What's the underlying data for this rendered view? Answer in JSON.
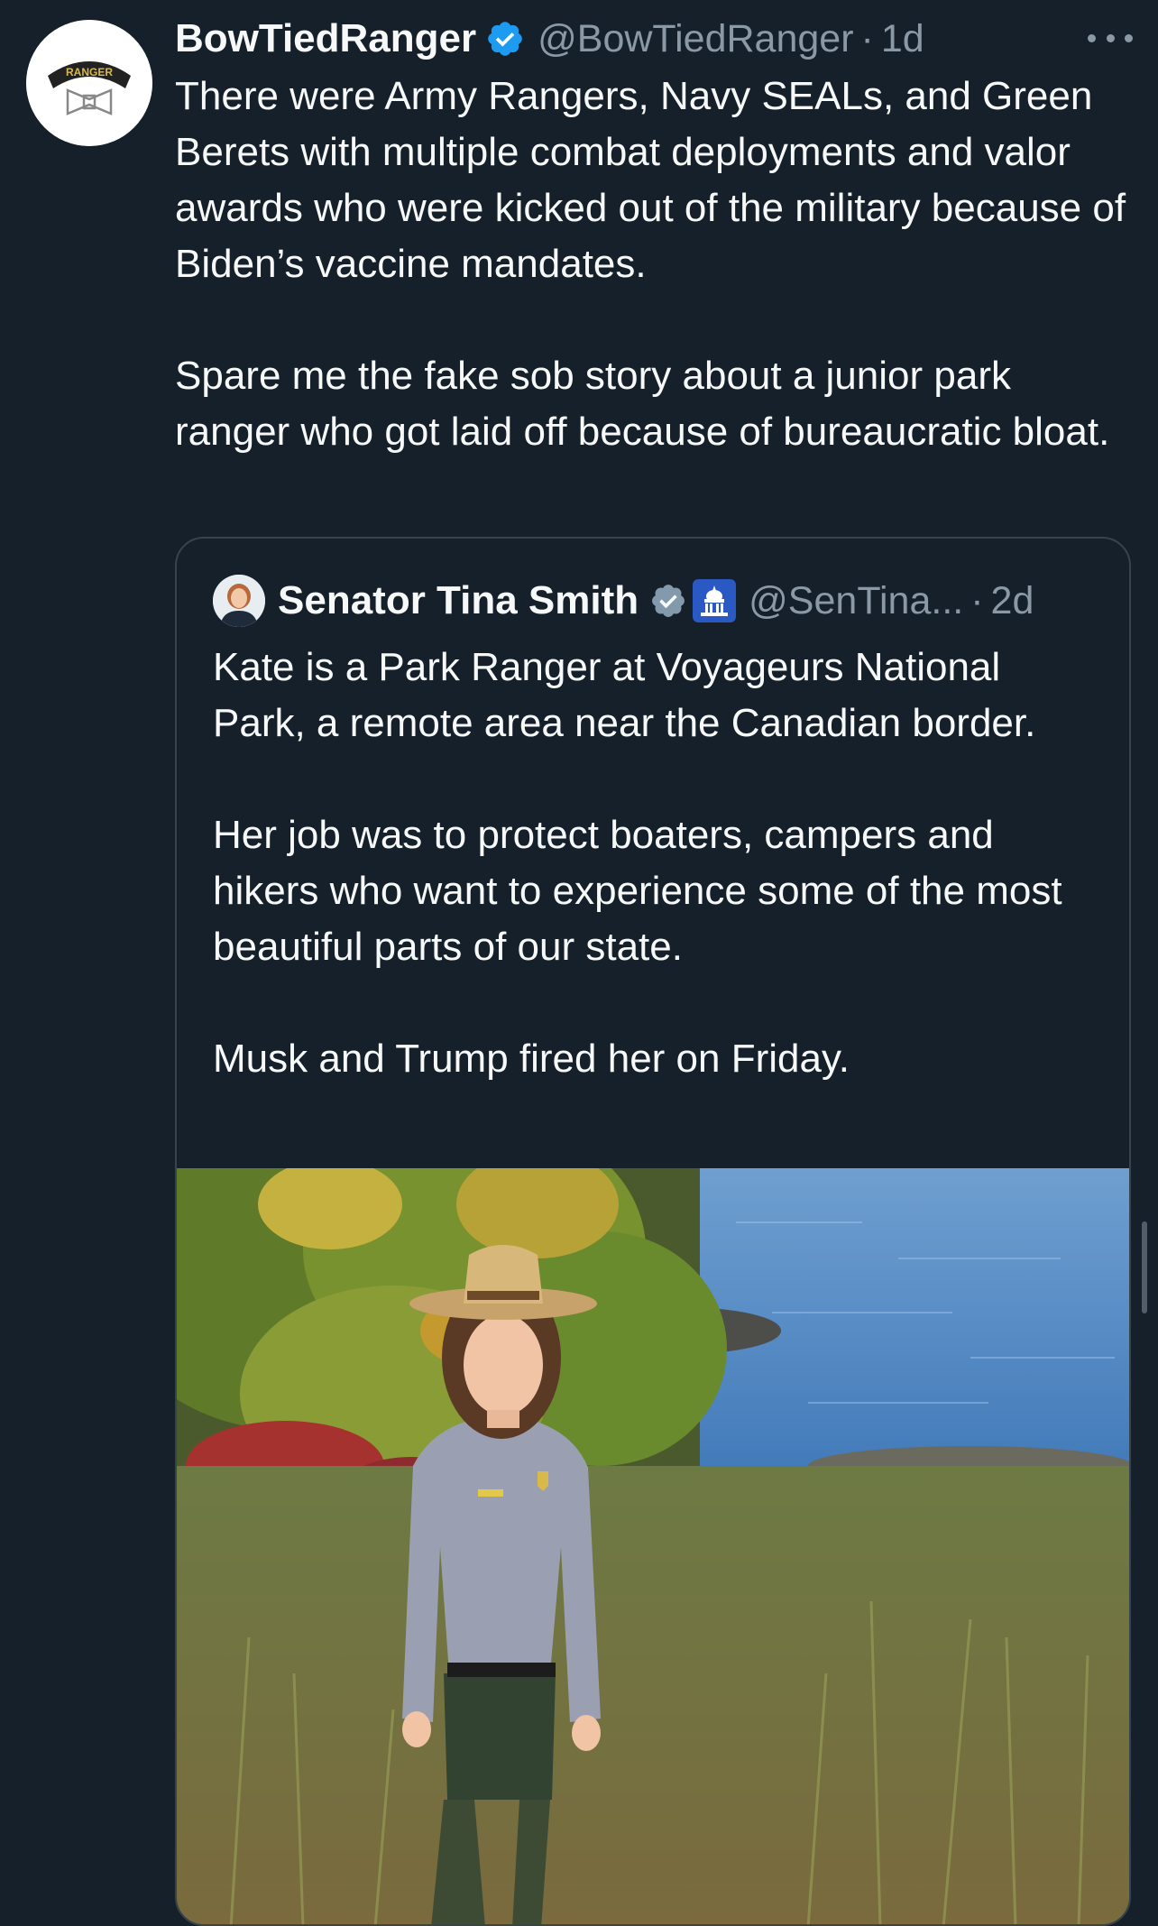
{
  "tweet": {
    "author": {
      "name": "BowTiedRanger",
      "handle": "@BowTiedRanger",
      "time": "1d",
      "avatar_icon": "ranger-tab-bowtie-avatar",
      "avatar_text": "RANGER"
    },
    "verified_icon": "verified-badge-icon",
    "more_icon": "more-options-icon",
    "paragraphs": [
      "There were Army Rangers, Navy SEALs, and Green Berets with multiple combat deployments and valor awards who were kicked out of the military because of Biden’s vaccine mandates.",
      "Spare me the fake sob story about a junior park ranger who got laid off because of bureaucratic bloat."
    ],
    "separator": "·"
  },
  "quote": {
    "author": {
      "name": "Senator Tina Smith",
      "handle": "@SenTina...",
      "time": "2d",
      "avatar_icon": "senator-portrait-avatar"
    },
    "verified_icon": "gray-verified-badge-icon",
    "affiliation_icon": "us-capitol-government-badge-icon",
    "paragraphs": [
      "Kate is a Park Ranger at Voyageurs National Park, a remote area near the Canadian border.",
      "Her job was to protect boaters, campers and hikers who want to experience some of the most beautiful parts of our state.",
      "Musk and Trump fired her on Friday."
    ],
    "photo": {
      "subject": "park ranger in flat hat and gray uniform shirt standing in front of foliage and a lake"
    }
  },
  "colors": {
    "background": "#15202b",
    "text_primary": "#f7f9f9",
    "text_secondary": "#8b98a5",
    "verified_blue": "#1d9bf0",
    "verified_gray": "#829aab",
    "border": "#38444d"
  }
}
